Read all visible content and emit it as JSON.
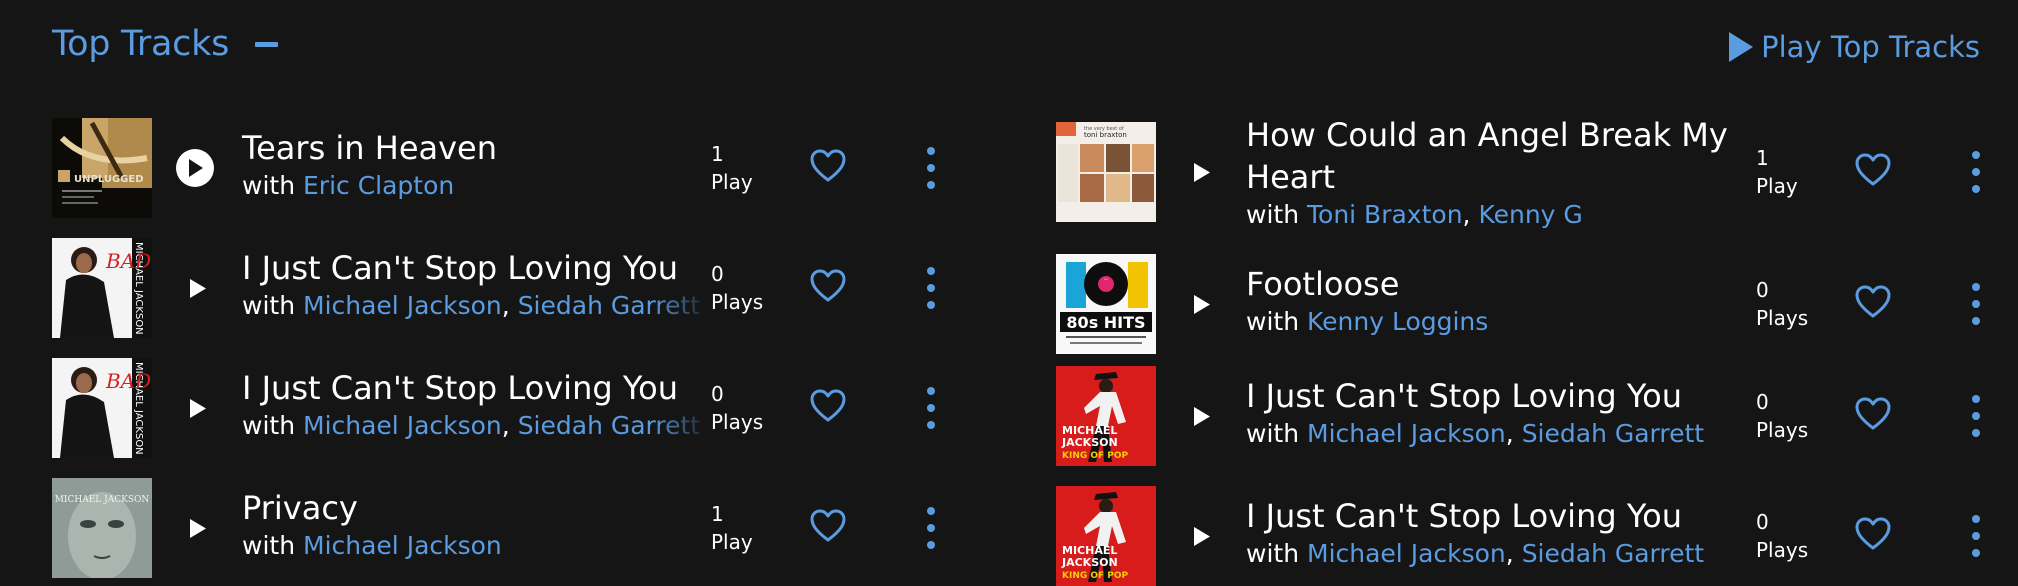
{
  "section": {
    "title": "Top Tracks",
    "play_label": "Play Top Tracks"
  },
  "left": [
    {
      "title": "Tears in Heaven",
      "with": "with",
      "artists": [
        "Eric Clapton"
      ],
      "plays_count": "1",
      "plays_label": "Play",
      "art": "unplugged"
    },
    {
      "title": "I Just Can't Stop Loving You",
      "with": "with",
      "artists": [
        "Michael Jackson",
        "Siedah Garrett"
      ],
      "plays_count": "0",
      "plays_label": "Plays",
      "art": "bad"
    },
    {
      "title": "I Just Can't Stop Loving You",
      "with": "with",
      "artists": [
        "Michael Jackson",
        "Siedah Garrett"
      ],
      "plays_count": "0",
      "plays_label": "Plays",
      "art": "bad"
    },
    {
      "title": "Privacy",
      "with": "with",
      "artists": [
        "Michael Jackson"
      ],
      "plays_count": "1",
      "plays_label": "Play",
      "art": "invincible"
    }
  ],
  "right": [
    {
      "title": "How Could an Angel Break My Heart",
      "with": "with",
      "artists": [
        "Toni Braxton",
        "Kenny G"
      ],
      "plays_count": "1",
      "plays_label": "Play",
      "art": "braxton"
    },
    {
      "title": "Footloose",
      "with": "with",
      "artists": [
        "Kenny Loggins"
      ],
      "plays_count": "0",
      "plays_label": "Plays",
      "art": "hits80"
    },
    {
      "title": "I Just Can't Stop Loving You",
      "with": "with",
      "artists": [
        "Michael Jackson",
        "Siedah Garrett"
      ],
      "plays_count": "0",
      "plays_label": "Plays",
      "art": "kingofpop"
    },
    {
      "title": "I Just Can't Stop Loving You",
      "with": "with",
      "artists": [
        "Michael Jackson",
        "Siedah Garrett"
      ],
      "plays_count": "0",
      "plays_label": "Plays",
      "art": "kingofpop"
    }
  ],
  "art_text": {
    "unplugged": "UNPLUGGED",
    "bad": "BAD",
    "bad_side": "MICHAEL JACKSON",
    "invincible": "MICHAEL JACKSON",
    "braxton_top": "the very best of",
    "braxton": "toni braxton",
    "hits_num": "101",
    "hits": "80s HITS",
    "kop_name": "MICHAEL JACKSON",
    "kop": "KING OF POP"
  },
  "colors": {
    "accent": "#5b9bdf",
    "background": "#151516",
    "text": "#ffffff"
  }
}
